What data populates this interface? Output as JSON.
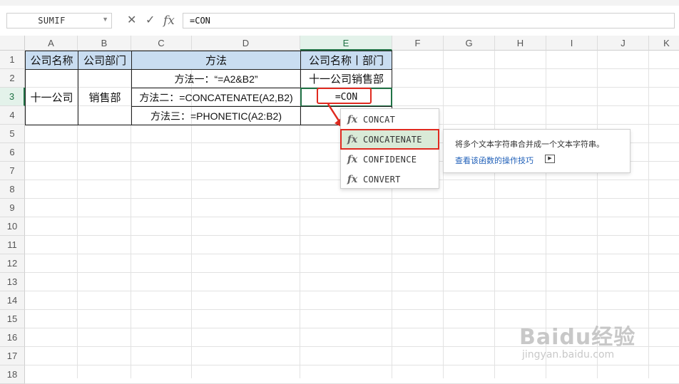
{
  "formula_bar": {
    "name_box": "SUMIF",
    "cancel_icon": "✕",
    "enter_icon": "✓",
    "fx_label": "fx",
    "formula": "=CON"
  },
  "columns": [
    "A",
    "B",
    "C",
    "D",
    "E",
    "F",
    "G",
    "H",
    "I",
    "J",
    "K"
  ],
  "active_column": "E",
  "rows": [
    "1",
    "2",
    "3",
    "4",
    "5",
    "6",
    "7",
    "8",
    "9",
    "10",
    "11",
    "12",
    "13",
    "14",
    "15",
    "16",
    "17",
    "18"
  ],
  "active_row": "3",
  "cells": {
    "A1": "公司名称",
    "B1": "公司部门",
    "CD1": "方法",
    "E1": "公司名称丨部门",
    "A2": "十一公司",
    "B2": "销售部",
    "CD2": "方法一：“=A2&B2”",
    "CD3": "方法二：=CONCATENATE(A2,B2)",
    "CD4": "方法三：=PHONETIC(A2:B2)",
    "E2": "十一公司销售部",
    "E3": "=CON"
  },
  "autocomplete": {
    "icon": "fx",
    "items": [
      "CONCAT",
      "CONCATENATE",
      "CONFIDENCE",
      "CONVERT"
    ],
    "highlighted": "CONCATENATE"
  },
  "tooltip": {
    "description": "将多个文本字符串合并成一个文本字符串。",
    "link": "查看该函数的操作技巧"
  },
  "watermark": {
    "main": "Baidu经验",
    "sub": "jingyan.baidu.com"
  },
  "colors": {
    "header_fill": "#c9ddf1",
    "accent_green": "#217346",
    "annotation_red": "#e02a1f",
    "highlight_fill": "#d9ead7"
  }
}
